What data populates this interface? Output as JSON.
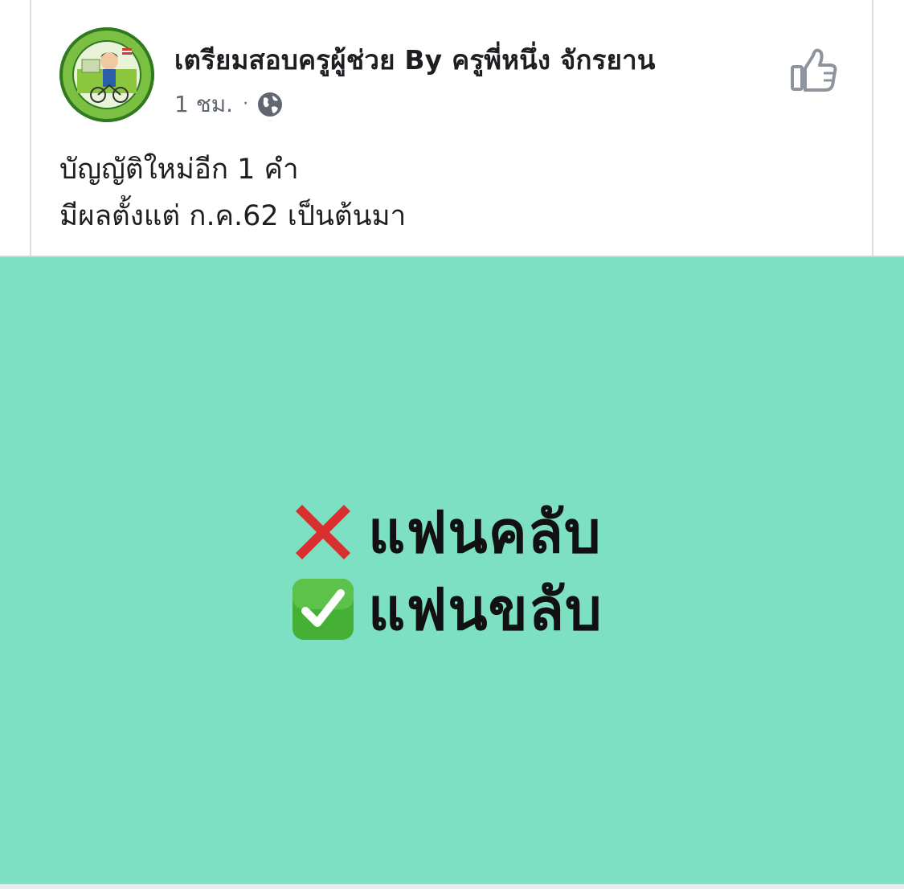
{
  "post": {
    "page_name": "เตรียมสอบครูผู้ช่วย By ครูพี่หนึ่ง จักรยาน",
    "time": "1 ชม.",
    "separator": "·",
    "privacy_icon": "globe-icon",
    "like_icon": "thumbs-up-icon",
    "avatar_icon": "page-logo-avatar",
    "text_lines": [
      "บัญญัติใหม่อีก 1 คำ",
      "มีผลตั้งแต่ ก.ค.62 เป็นต้นมา"
    ]
  },
  "image": {
    "background": "#7ee0c3",
    "lines": [
      {
        "icon": "cross-mark-icon",
        "text": "แฟนคลับ"
      },
      {
        "icon": "check-mark-icon",
        "text": "แฟนขลับ"
      }
    ]
  },
  "colors": {
    "text": "#1c1e21",
    "meta": "#606770",
    "cross": "#d9302f",
    "check_bg": "#45b035"
  }
}
